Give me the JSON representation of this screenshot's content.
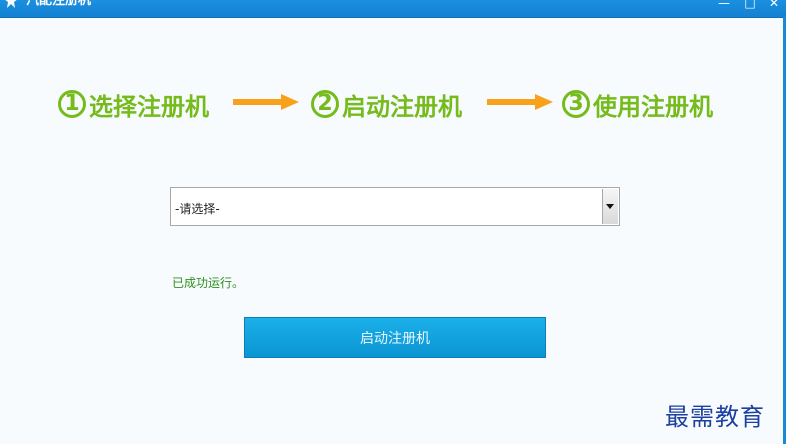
{
  "window": {
    "title": "汽配注册机",
    "controls": {
      "minimize": "—",
      "maximize": "□",
      "close": "✕"
    },
    "title_icon": "star-icon"
  },
  "steps": [
    {
      "number": "1",
      "label": "选择注册机"
    },
    {
      "number": "2",
      "label": "启动注册机"
    },
    {
      "number": "3",
      "label": "使用注册机"
    }
  ],
  "selector": {
    "value": "-请选择-",
    "icon": "dropdown-arrow-icon"
  },
  "status_text": "已成功运行。",
  "start_button_label": "启动注册机",
  "watermark": "最需教育",
  "colors": {
    "titlebar": "#1481d2",
    "step_green": "#76bb1c",
    "arrow_orange": "#f7a21a",
    "button_blue": "#0a95d3",
    "status_green": "#2f8f1e",
    "watermark_blue": "#1d3fa0"
  }
}
